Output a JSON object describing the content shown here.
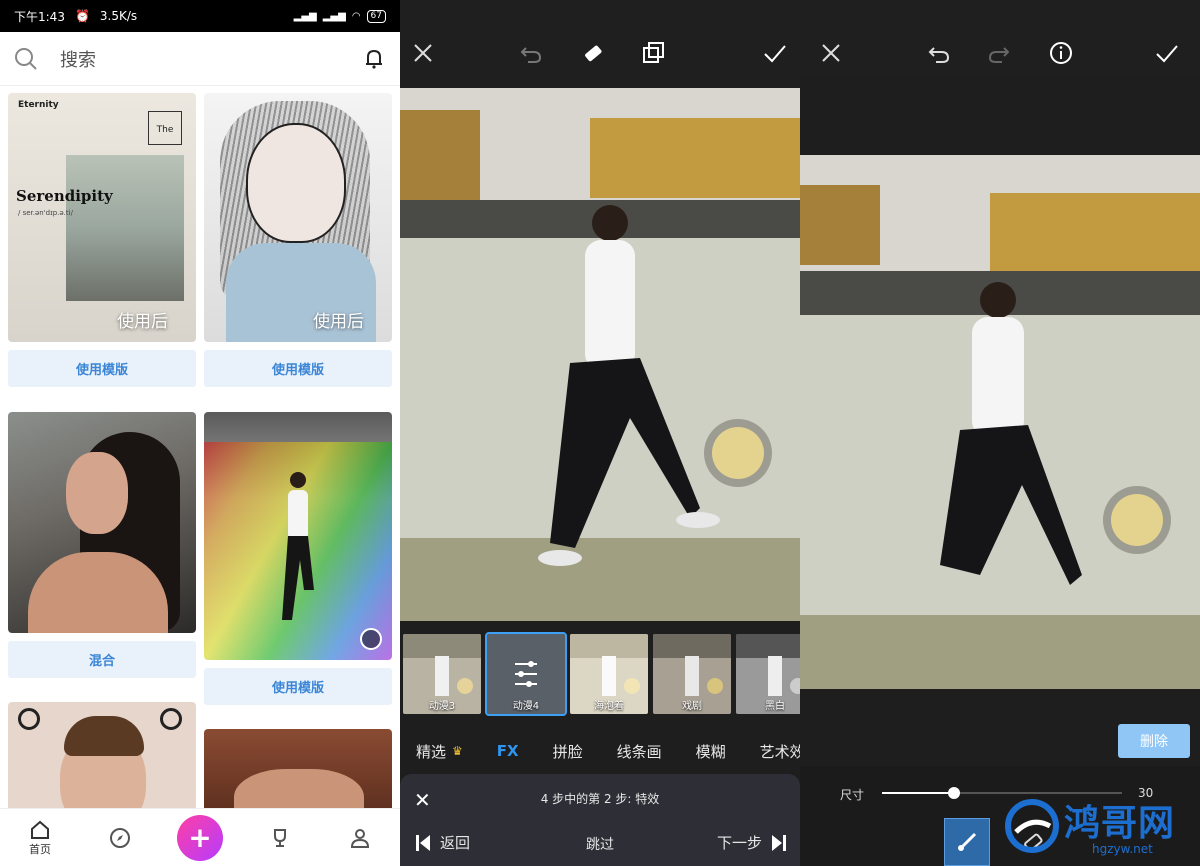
{
  "panel_feed": {
    "status": {
      "time": "下午1:43",
      "speed": "3.5K/s",
      "battery": "67"
    },
    "search": {
      "placeholder": "搜索"
    },
    "cards": [
      {
        "overlay": "使用后",
        "button": "使用模版",
        "eternity": "Eternity",
        "the": "The",
        "title": "Serendipity",
        "phonetic": "/ ser.ən'dɪp.ə.ti/"
      },
      {
        "overlay": "使用后",
        "button": "使用模版"
      },
      {
        "button": "混合"
      },
      {
        "button": "使用模版"
      }
    ],
    "nav": [
      {
        "label": "首页",
        "icon": "home-icon"
      },
      {
        "label": "",
        "icon": "compass-icon"
      },
      {
        "label": "+",
        "icon": "plus-icon"
      },
      {
        "label": "",
        "icon": "trophy-icon"
      },
      {
        "label": "",
        "icon": "profile-icon"
      }
    ]
  },
  "panel_fx": {
    "thumbnails": [
      "动漫3",
      "动漫4",
      "海泡着",
      "戏剧",
      "黑白"
    ],
    "selected_thumbnail": "动漫4",
    "categories": [
      "精选",
      "FX",
      "拼脸",
      "线条画",
      "模糊",
      "艺术效"
    ],
    "active_category": "FX",
    "step": {
      "title": "4 步中的第 2 步: 特效",
      "back": "返回",
      "skip": "跳过",
      "next": "下一步"
    }
  },
  "panel_eraser": {
    "delete_button": "删除",
    "size_label": "尺寸",
    "size_value": "30",
    "size_fraction": 0.3,
    "tools": [
      "brush-icon",
      "eraser-icon"
    ]
  },
  "watermark": {
    "title": "鸿哥网",
    "url": "hgzyw.net"
  },
  "colors": {
    "accent": "#2f95f0",
    "plus_gradient_start": "#ff3fa4",
    "plus_gradient_end": "#b53cff",
    "delete_button": "#8fc6f5"
  }
}
